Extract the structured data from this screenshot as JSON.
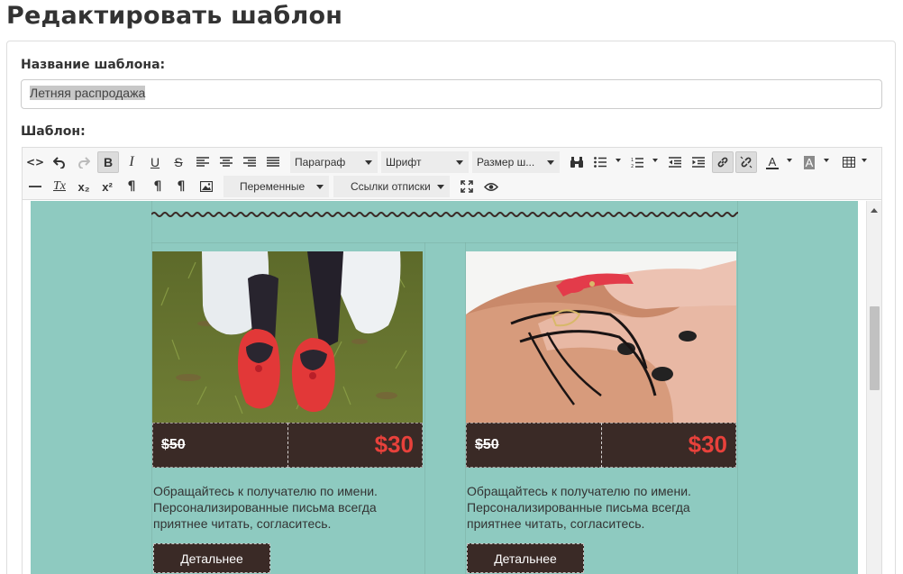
{
  "page": {
    "title": "Редактировать шаблон"
  },
  "form": {
    "name_label": "Название шаблона:",
    "name_value": "Летняя распродажа",
    "template_label": "Шаблон:"
  },
  "toolbar": {
    "paragraph": "Параграф",
    "font": "Шрифт",
    "font_size": "Размер ш...",
    "variables": "Переменные",
    "unsubscribe_links": "Ссылки отписки",
    "bold_glyph": "B",
    "italic_glyph": "I",
    "underline_glyph": "U",
    "strike_glyph": "S",
    "source_glyph": "<>",
    "clear_format_glyph": "Tx",
    "sub_glyph": "x₂",
    "sup_glyph": "x²",
    "text_color_glyph": "A",
    "bg_color_glyph": "A",
    "pilcrow_glyph": "¶"
  },
  "products": [
    {
      "old_price": "$50",
      "new_price": "$30",
      "text": "Обращайтесь к получателю по имени. Персонализированные письма всегда приятнее читать, согласитесь.",
      "button": "Детальнее"
    },
    {
      "old_price": "$50",
      "new_price": "$30",
      "text": "Обращайтесь к получателю по имени. Персонализированные письма всегда приятнее читать, согласитесь.",
      "button": "Детальнее"
    }
  ],
  "colors": {
    "canvas": "#8ecac0",
    "price_bar": "#3a2a26",
    "new_price": "#e8413b"
  }
}
